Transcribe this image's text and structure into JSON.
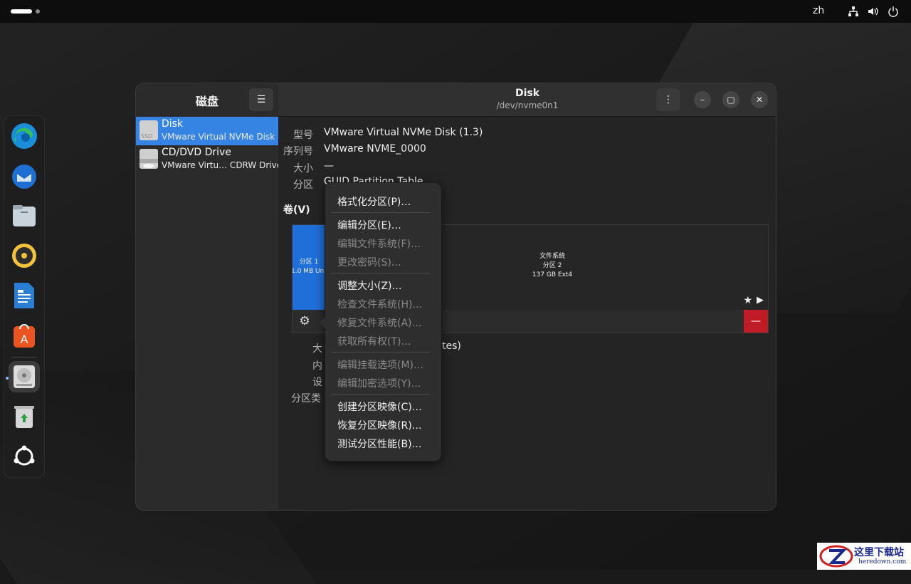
{
  "topbar": {
    "language": "zh",
    "icons": [
      "network-icon",
      "volume-icon",
      "power-icon"
    ]
  },
  "dock": {
    "apps": [
      "edge-browser-icon",
      "thunderbird-icon",
      "files-icon",
      "rhythmbox-icon",
      "libreoffice-writer-icon",
      "app-center-icon",
      "disks-icon",
      "trash-icon",
      "ubuntu-apps-icon"
    ]
  },
  "window": {
    "sidebar": {
      "title": "磁盘",
      "disks": [
        {
          "name": "Disk",
          "subtitle": "VMware Virtual NVMe Disk",
          "badge": "SSD",
          "selected": true
        },
        {
          "name": "CD/DVD Drive",
          "subtitle": "VMware Virtu… CDRW Drive",
          "selected": false
        }
      ]
    },
    "header": {
      "title": "Disk",
      "subtitle": "/dev/nvme0n1"
    },
    "info": [
      {
        "label": "型号",
        "value": "VMware Virtual NVMe Disk (1.3)"
      },
      {
        "label": "序列号",
        "value": "VMware NVME_0000"
      },
      {
        "label": "大小",
        "value": "—"
      },
      {
        "label": "分区",
        "value": "GUID Partition Table"
      }
    ],
    "volumes_label": "卷(V)",
    "partitions": [
      {
        "line1": "分区 1",
        "line2": "1.0 MB Unknown"
      },
      {
        "line1": "文件系统",
        "line2": "分区 2",
        "line3": "137 GB Ext4"
      }
    ],
    "details": [
      {
        "label": "大小",
        "value": "(… bytes)"
      },
      {
        "label": "内容",
        "value": ""
      },
      {
        "label": "设备",
        "value": ""
      },
      {
        "label": "分区类型",
        "value": ""
      }
    ],
    "details_visible": {
      "label_fragments": [
        "大",
        "内",
        "设",
        "分区类"
      ],
      "value_fragment": "tes)"
    }
  },
  "context_menu": {
    "items": [
      {
        "label": "格式化分区(P)…",
        "enabled": true
      },
      {
        "label": "编辑分区(E)…",
        "enabled": true
      },
      {
        "label": "编辑文件系统(F)…",
        "enabled": false
      },
      {
        "label": "更改密码(S)…",
        "enabled": false
      },
      {
        "label": "调整大小(Z)…",
        "enabled": true
      },
      {
        "label": "检查文件系统(H)…",
        "enabled": false
      },
      {
        "label": "修复文件系统(A)…",
        "enabled": false
      },
      {
        "label": "获取所有权(T)…",
        "enabled": false
      },
      {
        "label": "编辑挂载选项(M)…",
        "enabled": false
      },
      {
        "label": "编辑加密选项(Y)…",
        "enabled": false
      },
      {
        "label": "创建分区映像(C)…",
        "enabled": true
      },
      {
        "label": "恢复分区映像(R)…",
        "enabled": true
      },
      {
        "label": "测试分区性能(B)…",
        "enabled": true
      }
    ]
  },
  "watermark": {
    "text": "这里下载站",
    "sub": "heredown.com"
  },
  "colors": {
    "accent": "#3584e4",
    "partition_blue": "#1f6fd9",
    "destructive": "#c01c28"
  }
}
